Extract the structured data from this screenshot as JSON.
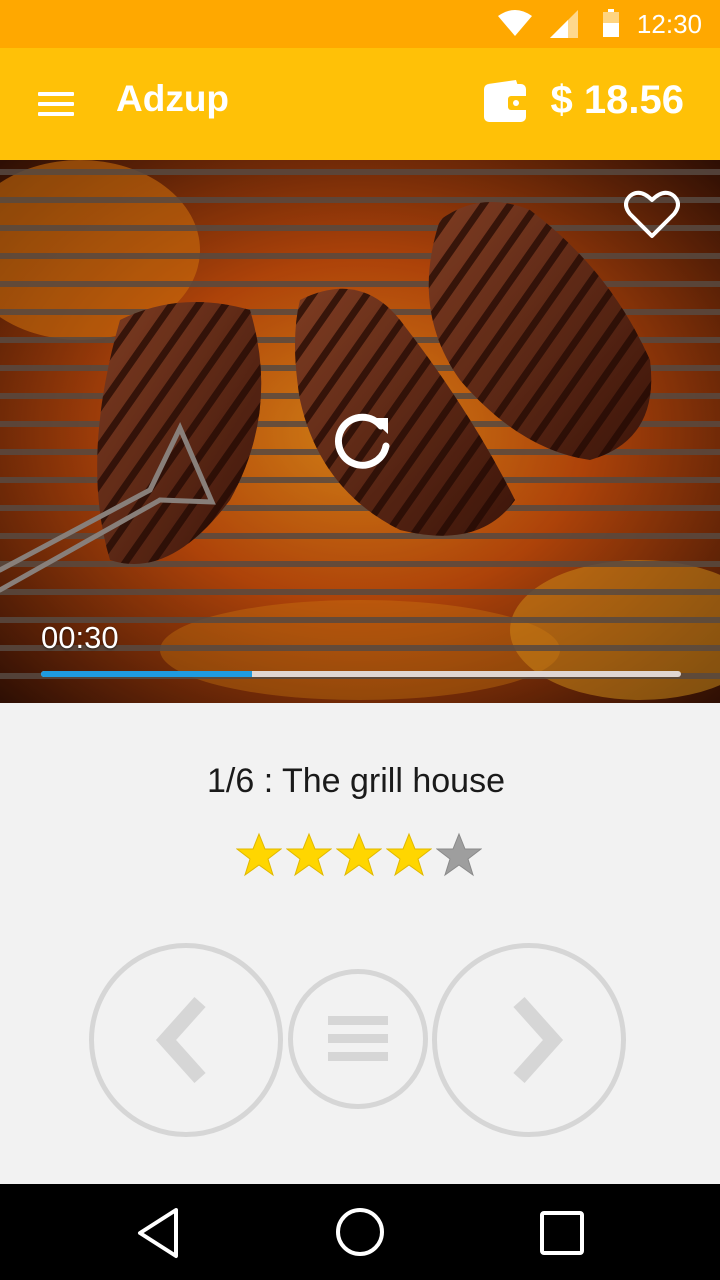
{
  "status_bar": {
    "time": "12:30",
    "icons": [
      "wifi-icon",
      "cell-signal-icon",
      "battery-icon"
    ],
    "color": "#ffa800"
  },
  "app_bar": {
    "menu_icon": "hamburger-menu-icon",
    "title": "Adzup",
    "wallet_icon": "wallet-icon",
    "balance": "$ 18.56",
    "color": "#ffc107"
  },
  "video": {
    "favorite_icon": "heart-outline-icon",
    "replay_icon": "replay-icon",
    "elapsed": "00:30",
    "progress_fraction": 0.33,
    "progress_color": "#1e9be0"
  },
  "ad": {
    "title": "1/6 : The grill house",
    "rating": 4,
    "rating_max": 5,
    "star_on_color": "#ffd600",
    "star_off_color": "#9e9e9e"
  },
  "controls": {
    "previous_icon": "chevron-left-icon",
    "list_icon": "list-icon",
    "next_icon": "chevron-right-icon",
    "color": "#d6d6d6"
  },
  "nav_bar": {
    "icons": [
      "back-triangle-icon",
      "home-circle-icon",
      "recents-square-icon"
    ]
  }
}
